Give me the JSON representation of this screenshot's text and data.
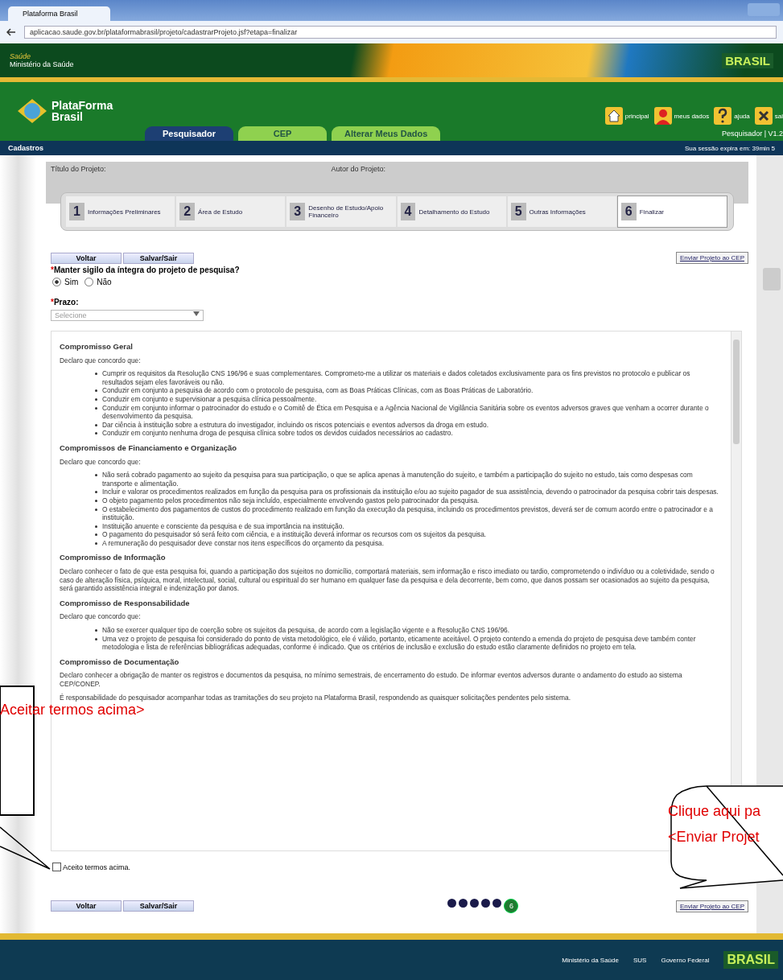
{
  "browser": {
    "tab_title": "Plataforma Brasil",
    "url": "aplicacao.saude.gov.br/plataformabrasil/projeto/cadastrarProjeto.jsf?etapa=finalizar"
  },
  "gov_bar": {
    "top_line": "Saúde",
    "ministry": "Ministério da Saúde",
    "brand": "BRASIL"
  },
  "header": {
    "logo_line_1": "PlataForma",
    "logo_line_2": "Brasil",
    "tabs": [
      {
        "label": "Pesquisador",
        "selected": true
      },
      {
        "label": "CEP",
        "selected": false
      },
      {
        "label": "Alterar Meus Dados",
        "selected": false
      }
    ],
    "links": [
      {
        "kind": "home",
        "label": "principal"
      },
      {
        "kind": "person",
        "label": "meus dados"
      },
      {
        "kind": "help",
        "label": "ajuda"
      },
      {
        "kind": "exit",
        "label": "sai"
      }
    ],
    "user": "Pesquisador | V1.2"
  },
  "nav": {
    "menu": "Cadastros",
    "session": "Sua sessão expira em: 39min 5"
  },
  "project": {
    "title_label": "Título do Projeto:",
    "author_label": "Autor do Projeto:"
  },
  "steps": [
    {
      "number": "1",
      "label": "Informações Preliminares",
      "selected": false
    },
    {
      "number": "2",
      "label": "Área de Estudo",
      "selected": false
    },
    {
      "number": "3",
      "label": "Desenho de Estudo/Apoio Financeiro",
      "selected": false
    },
    {
      "number": "4",
      "label": "Detalhamento do Estudo",
      "selected": false
    },
    {
      "number": "5",
      "label": "Outras Informações",
      "selected": false
    },
    {
      "number": "6",
      "label": "Finalizar",
      "selected": true
    }
  ],
  "top_buttons": [
    "Voltar",
    "Salvar/Sair"
  ],
  "send_button": "Enviar Projeto ao CEP",
  "question": {
    "required": "*",
    "text": "Manter sigilo da íntegra do projeto de pesquisa?",
    "options": [
      {
        "label": "Sim",
        "selected": true
      },
      {
        "label": "Não",
        "selected": false
      }
    ]
  },
  "deadline": {
    "required": "*",
    "label": "Prazo:",
    "value": "Selecione"
  },
  "terms": [
    {
      "title": "Compromisso Geral",
      "intro": "Declaro que concordo que:",
      "items": [
        "Cumprir os requisitos da Resolução CNS 196/96 e suas complementares. Comprometo-me a utilizar os materiais e dados coletados exclusivamente para os fins previstos no protocolo e publicar os resultados sejam eles favoráveis ou não.",
        "Conduzir em conjunto a pesquisa de acordo com o protocolo de pesquisa, com as Boas Práticas Clínicas, com as Boas Práticas de Laboratório.",
        "Conduzir em conjunto e supervisionar a pesquisa clínica pessoalmente.",
        "Conduzir em conjunto informar o patrocinador do estudo e o Comitê de Ética em Pesquisa e a Agência Nacional de Vigilância Sanitária sobre os eventos adversos graves que venham a ocorrer durante o desenvolvimento da pesquisa.",
        "Dar ciência à instituição sobre a estrutura do investigador, incluindo os riscos potenciais e eventos adversos da droga em estudo.",
        "Conduzir em conjunto nenhuma droga de pesquisa clínica sobre todos os devidos cuidados necessários ao cadastro."
      ]
    },
    {
      "title": "Compromissos de Financiamento e Organização",
      "intro": "Declaro que concordo que:",
      "items": [
        "Não será cobrado pagamento ao sujeito da pesquisa para sua participação, o que se aplica apenas à manutenção do sujeito, e também a participação do sujeito no estudo, tais como despesas com transporte e alimentação.",
        "Incluir e valorar os procedimentos realizados em função da pesquisa para os profissionais da instituição e/ou ao sujeito pagador de sua assistência, devendo o patrocinador da pesquisa cobrir tais despesas.",
        "O objeto pagamento pelos procedimentos não seja incluído, especialmente envolvendo gastos pelo patrocinador da pesquisa.",
        "O estabelecimento dos pagamentos de custos do procedimento realizado em função da execução da pesquisa, incluindo os procedimentos previstos, deverá ser de comum acordo entre o patrocinador e a instituição.",
        "Instituição anuente e consciente da pesquisa e de sua importância na instituição.",
        "O pagamento do pesquisador só será feito com ciência, e a instituição deverá informar os recursos com os sujeitos da pesquisa.",
        "A remuneração do pesquisador deve constar nos itens específicos do orçamento da pesquisa."
      ]
    },
    {
      "title": "Compromisso de Informação",
      "text": "Declaro conhecer o fato de que esta pesquisa foi, quando a participação dos sujeitos no domicílio, comportará materiais, sem informação e risco imediato ou tardio, comprometendo o indivíduo ou a coletividade, sendo o caso de alteração física, psíquica, moral, intelectual, social, cultural ou espiritual do ser humano em qualquer fase da pesquisa e dela decorrente, bem como, que danos possam ser ocasionados ao sujeito da pesquisa, será garantido assistência integral e indenização por danos."
    },
    {
      "title": "Compromisso de Responsabilidade",
      "intro": "Declaro que concordo que:",
      "items": [
        "Não se exercer qualquer tipo de coerção sobre os sujeitos da pesquisa, de acordo com a legislação vigente e a Resolução CNS 196/96.",
        "Uma vez o projeto de pesquisa foi considerado do ponto de vista metodológico, ele é válido, portanto, eticamente aceitável. O projeto contendo a emenda do projeto de pesquisa deve também conter metodologia e lista de referências bibliográficas adequadas, conforme é indicado. Que os critérios de inclusão e exclusão do estudo estão claramente definidos no projeto em tela."
      ]
    },
    {
      "title": "Compromisso de Documentação",
      "text": "Declaro conhecer a obrigação de manter os registros e documentos da pesquisa, no mínimo semestrais, de encerramento do estudo. De informar eventos adversos durante o andamento do estudo ao sistema CEP/CONEP."
    },
    {
      "text": "É responsabilidade do pesquisador acompanhar todas as tramitações do seu projeto na Plataforma Brasil, respondendo as quaisquer solicitações pendentes pelo sistema."
    }
  ],
  "accept": {
    "label": "Aceito termos acima.",
    "checked": false
  },
  "bottom_buttons": [
    "Voltar",
    "Salvar/Sair"
  ],
  "bottom_send_button": "Enviar Projeto ao CEP",
  "progress": [
    {
      "selected": false
    },
    {
      "selected": false
    },
    {
      "selected": false
    },
    {
      "selected": false
    },
    {
      "selected": false
    },
    {
      "selected": true,
      "label": "6"
    }
  ],
  "callouts": [
    {
      "kind": "left",
      "text": "Aceitar termos acima>"
    },
    {
      "kind": "right",
      "line_1": "Clique aqui pa",
      "line_2": "<Enviar Projet"
    }
  ],
  "footer": {
    "logos": [
      "Ministério da Saúde",
      "SUS",
      "Governo Federal"
    ],
    "brand": "BRASIL"
  }
}
